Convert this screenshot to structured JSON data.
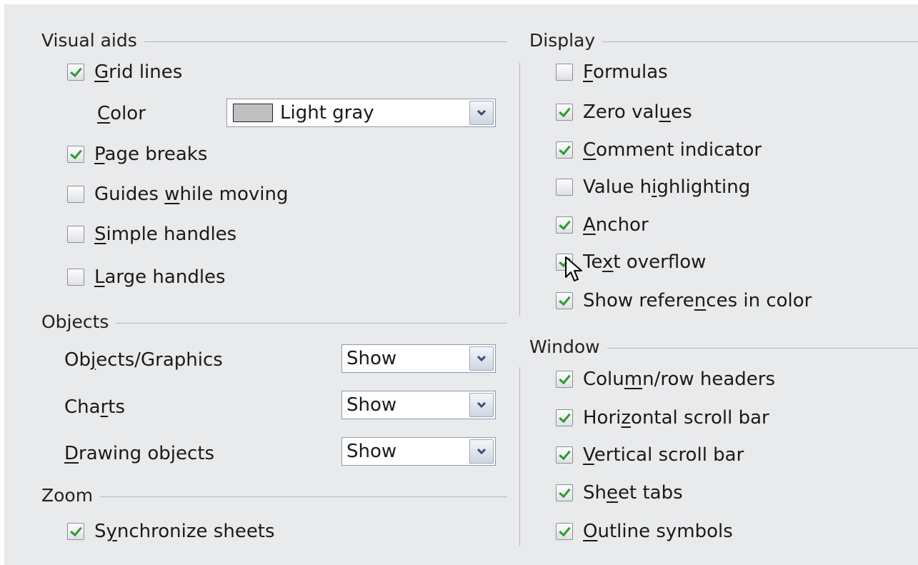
{
  "visual_aids": {
    "title": "Visual aids",
    "grid_lines": {
      "pre": "",
      "u": "G",
      "post": "rid lines",
      "checked": true
    },
    "color_label": {
      "pre": "",
      "u": "C",
      "post": "olor"
    },
    "color_value": "Light gray",
    "color_swatch": "#c0c0c0",
    "page_breaks": {
      "pre": "",
      "u": "P",
      "post": "age breaks",
      "checked": true
    },
    "guides_while_moving": {
      "pre": "Guides ",
      "u": "w",
      "post": "hile moving",
      "checked": false
    },
    "simple_handles": {
      "pre": "",
      "u": "S",
      "post": "imple handles",
      "checked": false
    },
    "large_handles": {
      "pre": "",
      "u": "L",
      "post": "arge handles",
      "checked": false
    }
  },
  "objects": {
    "title": "Objects",
    "objects_graphics": {
      "pre": "Ob",
      "u": "j",
      "post": "ects/Graphics",
      "value": "Show"
    },
    "charts": {
      "pre": "Cha",
      "u": "r",
      "post": "ts",
      "value": "Show"
    },
    "drawing_objects": {
      "pre": "",
      "u": "D",
      "post": "rawing objects",
      "value": "Show"
    }
  },
  "zoom": {
    "title": "Zoom",
    "synchronize_sheets": {
      "pre": "S",
      "u": "y",
      "post": "nchronize sheets",
      "checked": true
    }
  },
  "display": {
    "title": "Display",
    "formulas": {
      "pre": "",
      "u": "F",
      "post": "ormulas",
      "checked": false
    },
    "zero_values": {
      "pre": "Zero val",
      "u": "u",
      "post": "es",
      "checked": true
    },
    "comment_indicator": {
      "pre": "",
      "u": "C",
      "post": "omment indicator",
      "checked": true
    },
    "value_highlighting": {
      "pre": "Value h",
      "u": "i",
      "post": "ghlighting",
      "checked": false
    },
    "anchor": {
      "pre": "",
      "u": "A",
      "post": "nchor",
      "checked": true
    },
    "text_overflow": {
      "pre": "Te",
      "u": "x",
      "post": "t overflow",
      "checked": true
    },
    "show_references": {
      "pre": "Show refere",
      "u": "n",
      "post": "ces in color",
      "checked": true
    }
  },
  "window": {
    "title": "Window",
    "column_row_headers": {
      "pre": "Colu",
      "u": "m",
      "post": "n/row headers",
      "checked": true
    },
    "horizontal_scroll_bar": {
      "pre": "Hori",
      "u": "z",
      "post": "ontal scroll bar",
      "checked": true
    },
    "vertical_scroll_bar": {
      "pre": "",
      "u": "V",
      "post": "ertical scroll bar",
      "checked": true
    },
    "sheet_tabs": {
      "pre": "Sh",
      "u": "e",
      "post": "et tabs",
      "checked": true
    },
    "outline_symbols": {
      "pre": "",
      "u": "O",
      "post": "utline symbols",
      "checked": true
    }
  },
  "colors": {
    "check_mark": "#2e9a2e",
    "panel_bg": "#e9eaec"
  },
  "icons": {
    "dropdown": "chevron-down-icon",
    "pointer": "mouse-pointer-icon"
  }
}
